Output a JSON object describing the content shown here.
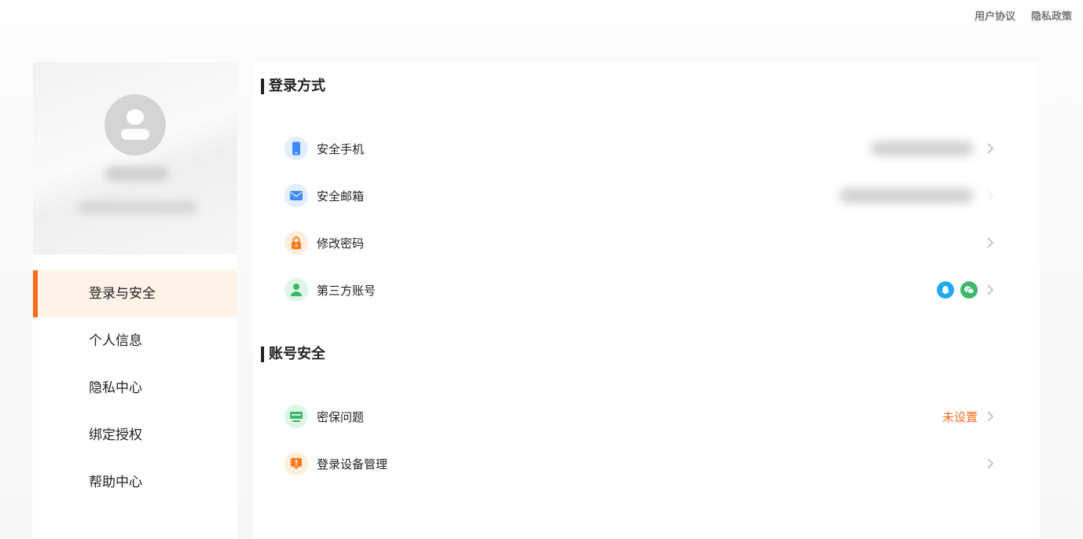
{
  "top_links": {
    "user_agreement": "用户协议",
    "privacy_policy": "隐私政策"
  },
  "sidebar": {
    "nav": [
      {
        "label": "登录与安全",
        "active": true
      },
      {
        "label": "个人信息",
        "active": false
      },
      {
        "label": "隐私中心",
        "active": false
      },
      {
        "label": "绑定授权",
        "active": false
      },
      {
        "label": "帮助中心",
        "active": false
      }
    ]
  },
  "login_methods": {
    "title": "登录方式",
    "items": [
      {
        "label": "安全手机",
        "icon": "phone-icon"
      },
      {
        "label": "安全邮箱",
        "icon": "mail-icon"
      },
      {
        "label": "修改密码",
        "icon": "lock-icon"
      },
      {
        "label": "第三方账号",
        "icon": "user-icon"
      }
    ]
  },
  "account_security": {
    "title": "账号安全",
    "items": [
      {
        "label": "密保问题",
        "icon": "monitor-icon",
        "status": "未设置"
      },
      {
        "label": "登录设备管理",
        "icon": "device-alert-icon"
      }
    ]
  },
  "colors": {
    "accent": "#ff6a1a",
    "active_bg": "#fff3e9",
    "qq": "#20a9f5",
    "wechat": "#3fb86b"
  }
}
